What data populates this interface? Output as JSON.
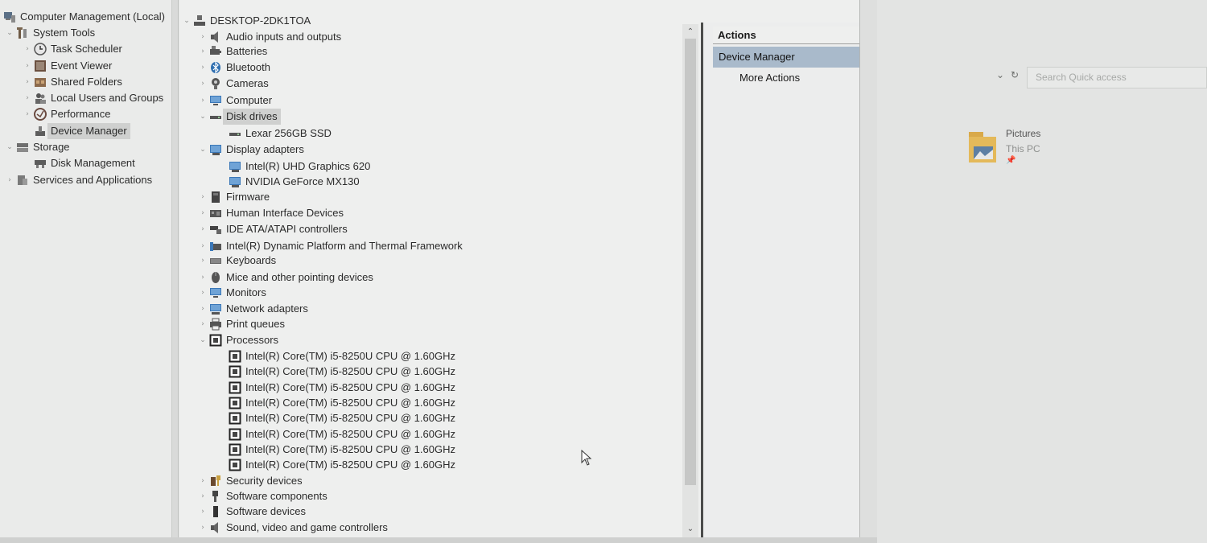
{
  "nav_tree": {
    "items": [
      {
        "label": "Computer Management (Local)",
        "icon": "computer-management-icon"
      },
      {
        "label": "System Tools",
        "icon": "tools-icon"
      },
      {
        "label": "Task Scheduler",
        "icon": "clock-icon"
      },
      {
        "label": "Event Viewer",
        "icon": "event-viewer-icon"
      },
      {
        "label": "Shared Folders",
        "icon": "shared-folder-icon"
      },
      {
        "label": "Local Users and Groups",
        "icon": "users-icon"
      },
      {
        "label": "Performance",
        "icon": "performance-icon"
      },
      {
        "label": "Device Manager",
        "icon": "device-manager-icon"
      },
      {
        "label": "Storage",
        "icon": "storage-icon"
      },
      {
        "label": "Disk Management",
        "icon": "disk-management-icon"
      },
      {
        "label": "Services and Applications",
        "icon": "services-icon"
      }
    ],
    "selected": "Device Manager"
  },
  "device_tree": {
    "root": "DESKTOP-2DK1TOA",
    "items": [
      {
        "label": "Audio inputs and outputs",
        "icon": "speaker-icon"
      },
      {
        "label": "Batteries",
        "icon": "battery-icon"
      },
      {
        "label": "Bluetooth",
        "icon": "bluetooth-icon"
      },
      {
        "label": "Cameras",
        "icon": "camera-icon"
      },
      {
        "label": "Computer",
        "icon": "monitor-icon"
      },
      {
        "label": "Disk drives",
        "icon": "disk-drive-icon"
      },
      {
        "label": "Lexar 256GB SSD",
        "icon": "disk-drive-icon"
      },
      {
        "label": "Display adapters",
        "icon": "display-adapter-icon"
      },
      {
        "label": "Intel(R) UHD Graphics 620",
        "icon": "display-adapter-icon"
      },
      {
        "label": "NVIDIA GeForce MX130",
        "icon": "display-adapter-icon"
      },
      {
        "label": "Firmware",
        "icon": "firmware-icon"
      },
      {
        "label": "Human Interface Devices",
        "icon": "hid-icon"
      },
      {
        "label": "IDE ATA/ATAPI controllers",
        "icon": "ide-controller-icon"
      },
      {
        "label": "Intel(R) Dynamic Platform and Thermal Framework",
        "icon": "thermal-framework-icon"
      },
      {
        "label": "Keyboards",
        "icon": "keyboard-icon"
      },
      {
        "label": "Mice and other pointing devices",
        "icon": "mouse-icon"
      },
      {
        "label": "Monitors",
        "icon": "monitor-icon"
      },
      {
        "label": "Network adapters",
        "icon": "network-icon"
      },
      {
        "label": "Print queues",
        "icon": "printer-icon"
      },
      {
        "label": "Processors",
        "icon": "processor-icon"
      },
      {
        "label": "Intel(R) Core(TM) i5-8250U CPU @ 1.60GHz",
        "icon": "processor-icon"
      },
      {
        "label": "Intel(R) Core(TM) i5-8250U CPU @ 1.60GHz",
        "icon": "processor-icon"
      },
      {
        "label": "Intel(R) Core(TM) i5-8250U CPU @ 1.60GHz",
        "icon": "processor-icon"
      },
      {
        "label": "Intel(R) Core(TM) i5-8250U CPU @ 1.60GHz",
        "icon": "processor-icon"
      },
      {
        "label": "Intel(R) Core(TM) i5-8250U CPU @ 1.60GHz",
        "icon": "processor-icon"
      },
      {
        "label": "Intel(R) Core(TM) i5-8250U CPU @ 1.60GHz",
        "icon": "processor-icon"
      },
      {
        "label": "Intel(R) Core(TM) i5-8250U CPU @ 1.60GHz",
        "icon": "processor-icon"
      },
      {
        "label": "Intel(R) Core(TM) i5-8250U CPU @ 1.60GHz",
        "icon": "processor-icon"
      },
      {
        "label": "Security devices",
        "icon": "security-icon"
      },
      {
        "label": "Software components",
        "icon": "software-component-icon"
      },
      {
        "label": "Software devices",
        "icon": "software-device-icon"
      },
      {
        "label": "Sound, video and game controllers",
        "icon": "speaker-icon"
      }
    ],
    "selected": "Disk drives"
  },
  "actions": {
    "header": "Actions",
    "section": "Device Manager",
    "more": "More Actions"
  },
  "background_window": {
    "search_placeholder": "Search Quick access",
    "folder_name": "Pictures",
    "folder_location": "This PC"
  },
  "colors": {
    "selection_bg": "#a9bacb",
    "tree_selected_bg": "#cfd0cf"
  }
}
